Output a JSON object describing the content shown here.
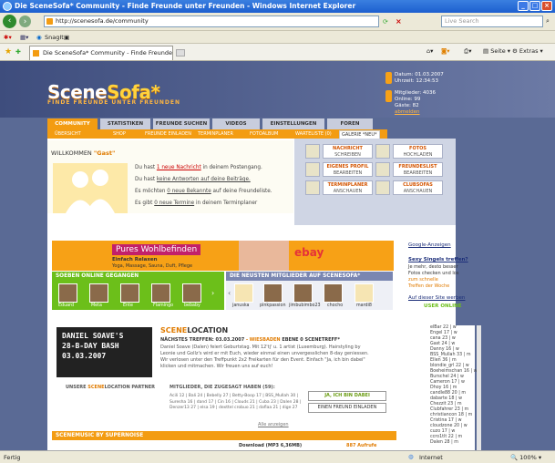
{
  "window": {
    "title": "Die SceneSofa* Community - Finde Freunde unter Freunden - Windows Internet Explorer",
    "url": "http://scenesofa.de/community",
    "search_placeholder": "Live Search",
    "tab_title": "Die SceneSofa* Community - Finde Freunde unter Fre...",
    "snagit": "SnagIt",
    "seite": "Seite",
    "extras": "Extras",
    "status": "Fertig",
    "zone": "Internet",
    "zoom": "100%"
  },
  "site": {
    "logo_main": "Scene",
    "logo_accent": "Sofa*",
    "slogan": "FINDE FREUNDE UNTER FREUNDEN",
    "date": "Datum: 01.03.2007",
    "time": "Uhrzeit: 12:34:53",
    "members": "Mitglieder: 4036",
    "online": "Online: 99",
    "guests": "Gäste: 82",
    "logout": "abmelden"
  },
  "nav": [
    "COMMUNITY",
    "STATISTIKEN",
    "FREUNDE SUCHEN",
    "VIDEOS",
    "EINSTELLUNGEN",
    "FOREN"
  ],
  "subnav": [
    "ÜBERSICHT",
    "SHOP",
    "FREUNDE EINLADEN",
    "TERMINPLANER",
    "FOTOALBUM",
    "WARTELISTE (0)",
    "GALERIE *NEU*"
  ],
  "welcome": {
    "label": "WILLKOMMEN",
    "name": "\"Gast\"",
    "l1a": "Du hast",
    "l1b": "1 neue Nachricht",
    "l1c": "in deinem Postengang.",
    "l2a": "Du hast",
    "l2b": "keine Antworten auf deine Beiträge.",
    "l3a": "Es möchten",
    "l3b": "0 neue Bekannte",
    "l3c": "auf deine Freundeliste.",
    "l4a": "Es gibt",
    "l4b": "0 neue Termine",
    "l4c": "in deinem Terminplaner"
  },
  "actions": [
    {
      "a": "NACHRICHT",
      "b": "SCHREIBEN"
    },
    {
      "a": "FOTOS",
      "b": "HOCHLADEN"
    },
    {
      "a": "EIGENES PROFIL",
      "b": "BEARBEITEN"
    },
    {
      "a": "FREUNDESLIST",
      "b": "BEARBEITEN"
    },
    {
      "a": "TERMINPLANER",
      "b": "ANSCHAUEN"
    },
    {
      "a": "CLUBSOFAS",
      "b": "ANSCHAUEN"
    }
  ],
  "ad": {
    "title": "Pures Wohlbefinden",
    "sub": "Einfach Relaxen",
    "sub2": "Yoga, Massage, Sauna, Duft, Pflege",
    "brand": "ebay",
    "google": "Google-Anzeigen",
    "sexy_title": "Sexy Singels treffen?",
    "sexy_text1": "Je mehr, desto besser",
    "sexy_text2": "Fotos checken und los",
    "sexy_text3": "zum schnelle",
    "sexy_text4": "Treffen der Woche",
    "ad_link": "Auf dieser Site werben"
  },
  "online_head": "SOEBEN ONLINE GEGANGEN",
  "online_users": [
    "Eduard",
    "Meta",
    "Ente",
    "Flamingo",
    "bebaby"
  ],
  "new_head": "DIE NEUSTEN MITGLIEDER AUF SCENESOFA*",
  "new_users": [
    "januska",
    "pinkpassion",
    "jimbubimbo23",
    "chocho",
    "mardi8"
  ],
  "location": {
    "party1": "DANIEL SOAVE'S",
    "party2": "28-B-DAY BASH",
    "party3": "03.03.2007",
    "title_a": "SCENE",
    "title_b": "LOCATION",
    "next_a": "NÄCHSTES TREFFEN:",
    "next_b": "03.03.2007",
    "next_c": "- WIESBADEN",
    "next_d": "EBENE 0 SCENETREFF*",
    "t1": "Daniel Soave (Dalen) feiert Geburtstag. Mit 12'tj' u. 1 artist (Luxemburg). Hairstyling by",
    "t2": "Leonie und Gollz's wird er mit Euch, wieder einmal einen unvergesslichen 8-day geniessen.",
    "t3": "Wir verlosen unter den Treffpunkt 2x2 Freikarten für den Event. Einfach \"Ja, ich bin dabei\"",
    "t4": "klicken und mitmachen. Wir freuen uns auf euch!",
    "partner_a": "UNSERE",
    "partner_b": "SCENE",
    "partner_c": "LOCATION PARTNER",
    "confirmed": "MITGLIEDER, DIE ZUGESAGT HABEN (59):",
    "confirmed_users": "Acili 12 | Bali 24 | Bebelly 27 | Betty-Boop 17 | BSS_Mullah 30 | Suresha 16 | dand 17 | Cin 16 | Clouds 21 | Cuba 23 | Dalen 28 | Denzer13 27 | elsa 19 | dexttel crobuo 21 | daflaa 21 | dige 27",
    "show_all": "Alle anzeigen",
    "yes_btn": "JA, ICH BIN DABEI",
    "invite_btn": "EINEN FREUND EINLADEN"
  },
  "music": {
    "head": "SCENEMUSIC BY SUPERNOISE",
    "download": "Download (MP3 6,36MB)",
    "record": "887 Aufrufe"
  },
  "user_online_head": "USER ONLINE",
  "users_online": [
    "elBar 22 | w",
    "Engel 17 | w",
    "cana 23 | w",
    "Gast 24 | w",
    "Danny 16 | w",
    "BSS_Mullah 33 | m",
    "Ellen 36 | m",
    "blondie_grl 22 | w",
    "Boeheimschan 16 | w",
    "Burschel 24 | w",
    "Cameron 17 | w",
    "Dhoy 16 | m",
    "candle88 20 | m",
    "dabarte 18 | w",
    "Chezzit 23 | m",
    "Clubfahrer 23 | m",
    "christiancon 18 | m",
    "Cristina 17 | w",
    "cloudzone 20 | w",
    "cuzo 17 | w",
    "ccro1tlt 22 | m",
    "Dalen 28 | m"
  ]
}
